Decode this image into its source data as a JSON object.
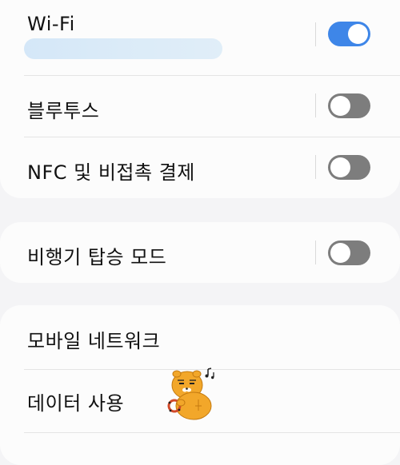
{
  "settings": {
    "wifi": {
      "label": "Wi-Fi",
      "enabled": true
    },
    "bluetooth": {
      "label": "블루투스",
      "enabled": false
    },
    "nfc": {
      "label": "NFC 및 비접촉 결제",
      "enabled": false
    },
    "airplane": {
      "label": "비행기 탑승 모드",
      "enabled": false
    },
    "mobile_network": {
      "label": "모바일 네트워크"
    },
    "data_usage": {
      "label": "데이터 사용"
    }
  },
  "colors": {
    "accent": "#3e86e8",
    "toggle_off": "#7d7d7d",
    "card": "#fcfcfc",
    "background": "#f4f4f6"
  }
}
